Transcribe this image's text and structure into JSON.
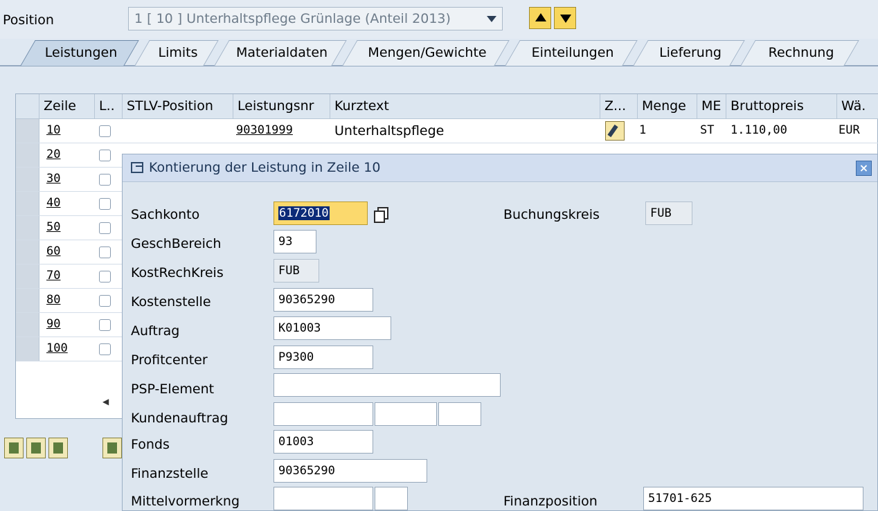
{
  "position": {
    "label": "Position",
    "dropdown_value": "1 [ 10 ] Unterhaltspflege Grünlage (Anteil 2013)"
  },
  "tabs": [
    {
      "label": "Leistungen",
      "active": true
    },
    {
      "label": "Limits"
    },
    {
      "label": "Materialdaten"
    },
    {
      "label": "Mengen/Gewichte"
    },
    {
      "label": "Einteilungen"
    },
    {
      "label": "Lieferung"
    },
    {
      "label": "Rechnung"
    }
  ],
  "table": {
    "headers": [
      "Zeile",
      "L..",
      "STLV-Position",
      "Leistungsnr",
      "Kurztext",
      "Z...",
      "Menge",
      "ME",
      "Bruttopreis",
      "Wä."
    ],
    "rows": [
      {
        "zeile": "10",
        "leistungsnr": "90301999",
        "kurztext": "Unterhaltspflege",
        "menge": "1",
        "me": "ST",
        "bruttopreis": "1.110,00",
        "waehrung": "EUR"
      },
      {
        "zeile": "20"
      },
      {
        "zeile": "30"
      },
      {
        "zeile": "40"
      },
      {
        "zeile": "50"
      },
      {
        "zeile": "60"
      },
      {
        "zeile": "70"
      },
      {
        "zeile": "80"
      },
      {
        "zeile": "90"
      },
      {
        "zeile": "100"
      }
    ]
  },
  "popup": {
    "title": "Kontierung der Leistung in Zeile 10",
    "close": "×",
    "fields": {
      "sachkonto": {
        "label": "Sachkonto",
        "value": "6172010"
      },
      "buchungskreis": {
        "label": "Buchungskreis",
        "value": "FUB"
      },
      "geschbereich": {
        "label": "GeschBereich",
        "value": "93"
      },
      "kostrechkreis": {
        "label": "KostRechKreis",
        "value": "FUB"
      },
      "kostenstelle": {
        "label": "Kostenstelle",
        "value": "90365290"
      },
      "auftrag": {
        "label": "Auftrag",
        "value": "K01003"
      },
      "profitcenter": {
        "label": "Profitcenter",
        "value": "P9300"
      },
      "psp_element": {
        "label": "PSP-Element",
        "value": ""
      },
      "kundenauftrag": {
        "label": "Kundenauftrag",
        "value": ""
      },
      "fonds": {
        "label": "Fonds",
        "value": "01003"
      },
      "finanzstelle": {
        "label": "Finanzstelle",
        "value": "90365290"
      },
      "mittelvormerkung": {
        "label": "Mittelvormerkng",
        "value": ""
      },
      "finanzposition": {
        "label": "Finanzposition",
        "value": "51701-625"
      }
    }
  },
  "colors": {
    "background": "#dfe8f2",
    "focus_field": "#fbd96d",
    "selection": "#0b2a78",
    "nav_button": "#f8d65b"
  }
}
